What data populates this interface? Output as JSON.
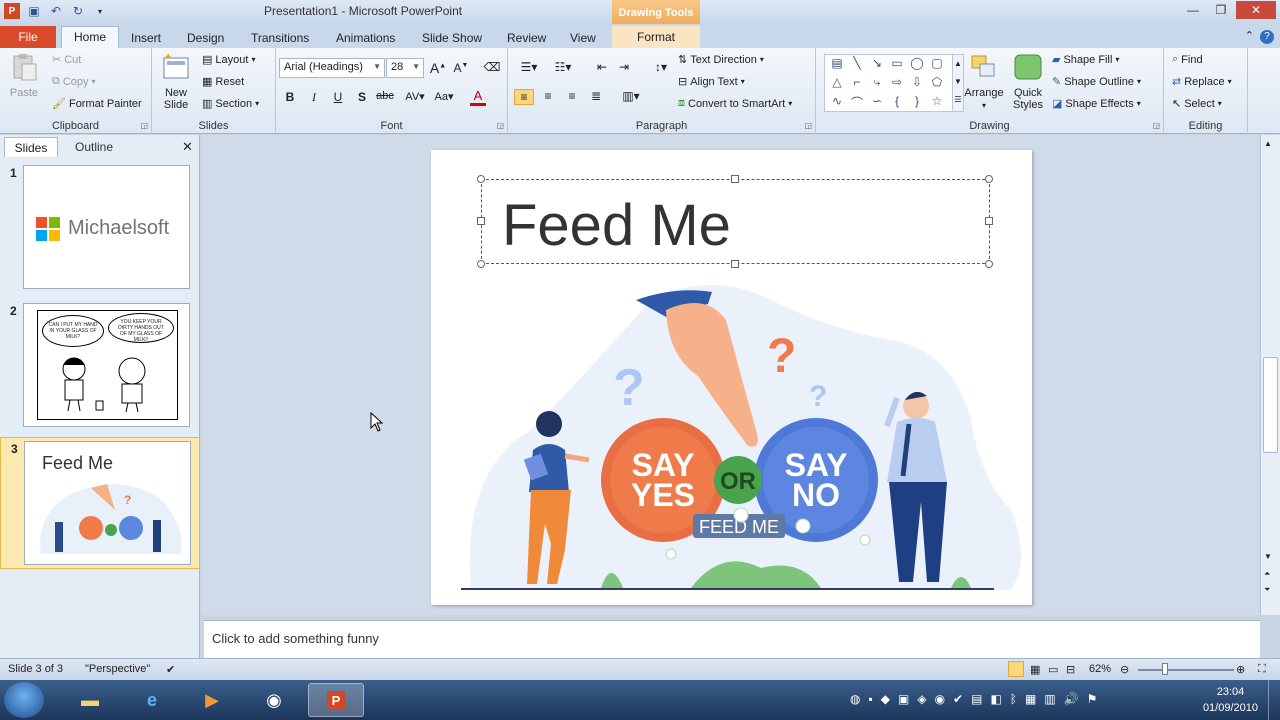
{
  "window": {
    "title": "Presentation1  -  Microsoft PowerPoint",
    "contextual_tab_header": "Drawing Tools"
  },
  "tabs": {
    "file": "File",
    "items": [
      "Home",
      "Insert",
      "Design",
      "Transitions",
      "Animations",
      "Slide Show",
      "Review",
      "View"
    ],
    "contextual": "Format"
  },
  "ribbon": {
    "clipboard": {
      "label": "Clipboard",
      "paste": "Paste",
      "cut": "Cut",
      "copy": "Copy",
      "format_painter": "Format Painter"
    },
    "slides": {
      "label": "Slides",
      "new_slide": "New Slide",
      "layout": "Layout",
      "reset": "Reset",
      "section": "Section"
    },
    "font": {
      "label": "Font",
      "font_name": "Arial (Headings)",
      "font_size": "28"
    },
    "paragraph": {
      "label": "Paragraph",
      "text_direction": "Text Direction",
      "align_text": "Align Text",
      "convert_smartart": "Convert to SmartArt"
    },
    "drawing": {
      "label": "Drawing",
      "arrange": "Arrange",
      "quick_styles": "Quick Styles",
      "shape_fill": "Shape Fill",
      "shape_outline": "Shape Outline",
      "shape_effects": "Shape Effects"
    },
    "editing": {
      "label": "Editing",
      "find": "Find",
      "replace": "Replace",
      "select": "Select"
    }
  },
  "panel": {
    "tab_slides": "Slides",
    "tab_outline": "Outline",
    "thumbnails": [
      {
        "num": "1",
        "text": "Michaelsoft"
      },
      {
        "num": "2",
        "bubble_left": "CAN I PUT MY HAND IN YOUR GLASS OF MILK?",
        "bubble_right": "YOU KEEP YOUR DIRTY HANDS OUT OF MY GLASS OF MILK!!"
      },
      {
        "num": "3",
        "text": "Feed Me"
      }
    ]
  },
  "slide": {
    "title": "Feed Me",
    "say_yes": [
      "SAY",
      "YES"
    ],
    "or": "OR",
    "say_no": [
      "SAY",
      "NO"
    ],
    "banner": "FEED ME"
  },
  "notes": {
    "placeholder": "Click to add something funny"
  },
  "status": {
    "slide_of": "Slide 3 of 3",
    "theme": "\"Perspective\"",
    "zoom": "62%"
  },
  "clock": {
    "time": "23:04",
    "date": "01/09/2010"
  },
  "colors": {
    "accent_orange": "#ef7a4a",
    "accent_blue": "#5c86e0",
    "green": "#49a34a",
    "file_tab": "#d94a2a"
  }
}
